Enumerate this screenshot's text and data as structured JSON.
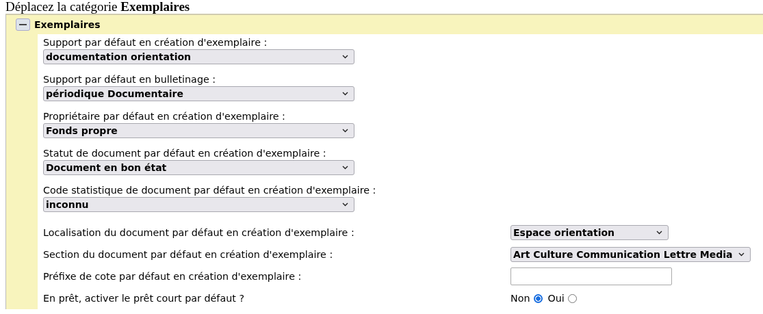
{
  "heading": "Déplacez la catégorie **Exemplaires**",
  "section": {
    "title": "Exemplaires",
    "expanded": true
  },
  "fields": [
    {
      "kind": "select",
      "label": "Support par défaut en création d'exemplaire :",
      "value": "documentation orientation"
    },
    {
      "kind": "select",
      "label": "Support par défaut en bulletinage :",
      "value": "périodique Documentaire"
    },
    {
      "kind": "select",
      "label": "Propriétaire par défaut en création d'exemplaire :",
      "value": "Fonds propre"
    },
    {
      "kind": "select",
      "label": "Statut de document par défaut en création d'exemplaire :",
      "value": "Document en bon état"
    },
    {
      "kind": "select",
      "label": "Code statistique de document par défaut en création d'exemplaire :",
      "value": "inconnu"
    },
    {
      "kind": "inline_select",
      "label": "Localisation du document par défaut en création d'exemplaire :",
      "value": "Espace orientation"
    },
    {
      "kind": "inline_select",
      "label": "Section du document par défaut en création d'exemplaire :",
      "value": "Art Culture Communication Lettre Media"
    },
    {
      "kind": "text",
      "label": "Préfixe de cote par défaut en création d'exemplaire :"
    },
    {
      "kind": "radio",
      "label": "En prêt, activer le prêt court par défaut ?",
      "options": [
        {
          "label": "Non",
          "selected": true
        },
        {
          "label": "Oui",
          "selected": false
        }
      ]
    }
  ]
}
